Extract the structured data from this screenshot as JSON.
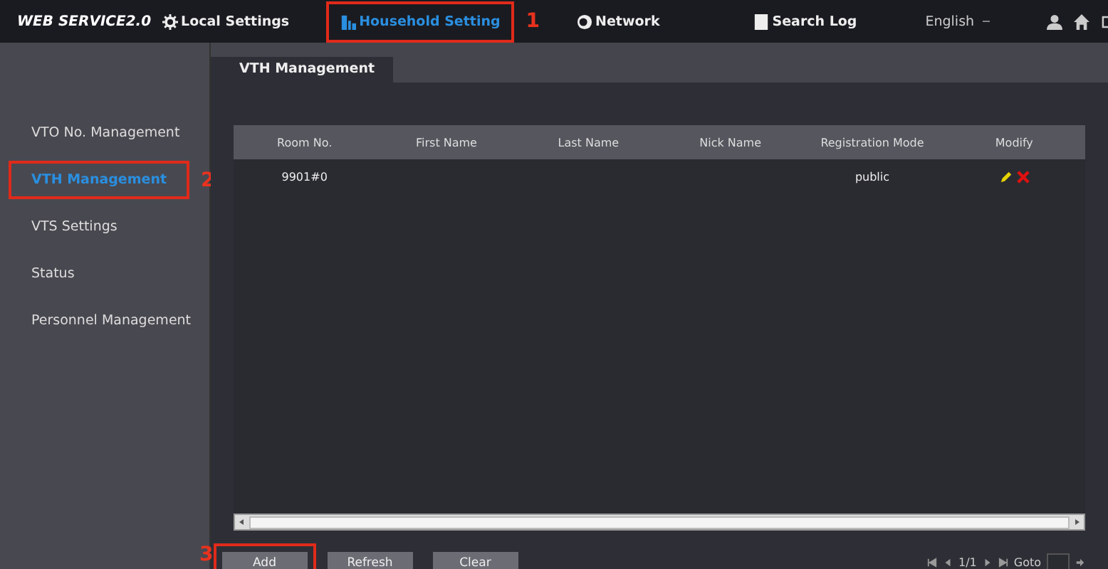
{
  "header": {
    "logo": "WEB SERVICE2.0",
    "nav": [
      {
        "label": "Local Settings",
        "selected": false
      },
      {
        "label": "Household Setting",
        "selected": true,
        "callout": "1"
      },
      {
        "label": "Network",
        "selected": false
      },
      {
        "label": "Search Log",
        "selected": false
      }
    ],
    "language": "English"
  },
  "sidebar": {
    "items": [
      {
        "label": "VTO No. Management",
        "selected": false
      },
      {
        "label": "VTH Management",
        "selected": true,
        "callout": "2"
      },
      {
        "label": "VTS Settings",
        "selected": false
      },
      {
        "label": "Status",
        "selected": false
      },
      {
        "label": "Personnel Management",
        "selected": false
      }
    ]
  },
  "tabs": [
    {
      "label": "VTH Management",
      "selected": true
    }
  ],
  "table": {
    "columns": [
      "Room No.",
      "First Name",
      "Last Name",
      "Nick Name",
      "Registration Mode",
      "Modify"
    ],
    "rows": [
      {
        "room_no": "9901#0",
        "registration_mode": "public"
      }
    ]
  },
  "buttons": [
    {
      "label": "Add",
      "callout": "3"
    },
    {
      "label": "Refresh"
    },
    {
      "label": "Clear"
    }
  ],
  "pager": {
    "page": "1/1",
    "goto_label": "Goto"
  }
}
